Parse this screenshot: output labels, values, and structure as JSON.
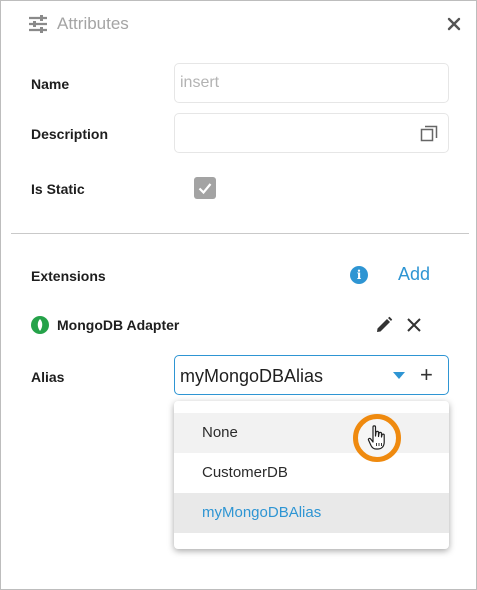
{
  "header": {
    "title": "Attributes",
    "icon": "sliders-icon",
    "close_icon": "close-icon"
  },
  "form": {
    "name_label": "Name",
    "name_value": "",
    "name_placeholder": "insert",
    "description_label": "Description",
    "description_value": "",
    "is_static_label": "Is Static",
    "is_static_checked": true
  },
  "extensions": {
    "label": "Extensions",
    "add_label": "Add",
    "info_icon": "i",
    "adapter": {
      "name": "MongoDB Adapter",
      "icon": "mongodb-leaf-icon"
    },
    "alias_label": "Alias",
    "alias_value": "myMongoDBAlias",
    "alias_add": "+",
    "options": [
      "None",
      "CustomerDB",
      "myMongoDBAlias"
    ],
    "hovered_option": "None",
    "selected_option": "myMongoDBAlias"
  },
  "colors": {
    "accent": "#2e95d3",
    "cursor_ring": "#ef8a0f",
    "leaf": "#25a249"
  }
}
